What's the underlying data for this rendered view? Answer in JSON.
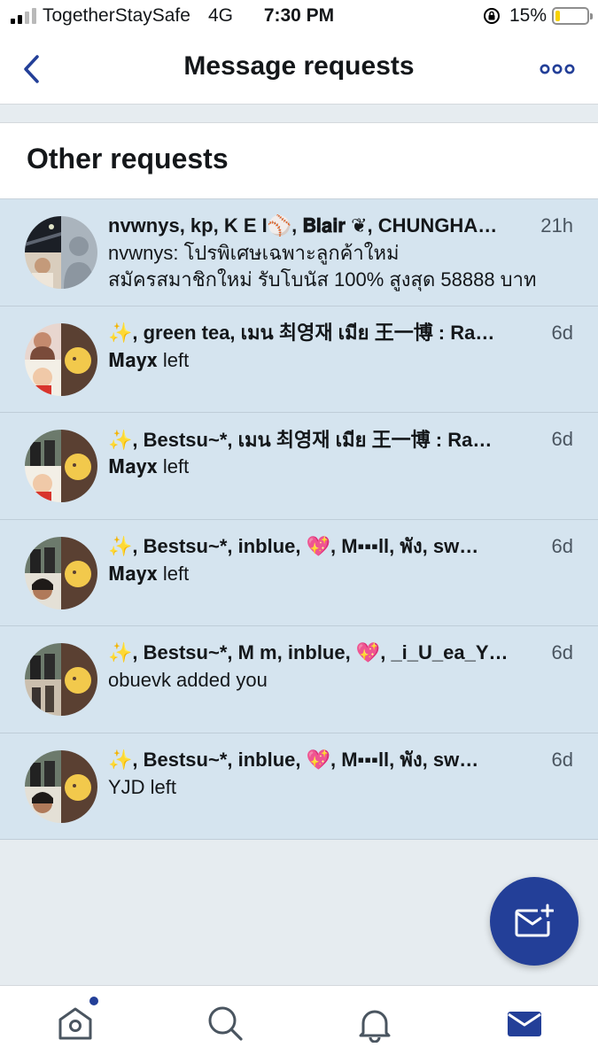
{
  "status_bar": {
    "carrier": "TogetherStaySafe",
    "network": "4G",
    "time": "7:30 PM",
    "battery": "15%",
    "battery_level": 0.15
  },
  "header": {
    "title": "Message requests",
    "back_icon": "chevron-left-icon",
    "more_icon": "more-horizontal-icon"
  },
  "section": {
    "title": "Other requests"
  },
  "requests": [
    {
      "names": "nvwnys, kp, K E I⚾️, 𝐁𝐥𝐚𝐢𝐫 ❦, CHUNGHA…",
      "time": "21h",
      "preview": "nvwnys: โปรพิเศษเฉพาะลูกค้าใหม่",
      "preview2": "สมัครสมาชิกใหม่ รับโบนัส 100% สูงสุด 58888 บาท"
    },
    {
      "names": "✨, green tea, เมน 최영재 เมีย 王一博 : Ra…",
      "time": "6d",
      "preview": "𝐌𝐚𝐲𝐱 left"
    },
    {
      "names": "✨, Bestsu~*, เมน 최영재 เมีย 王一博 : Ra…",
      "time": "6d",
      "preview": "𝐌𝐚𝐲𝐱 left"
    },
    {
      "names": "✨, Bestsu~*, inblue, 💖, M▪▪▪ll, พัง, sw…",
      "time": "6d",
      "preview": "𝐌𝐚𝐲𝐱 left"
    },
    {
      "names": "✨, Bestsu~*, M m, inblue, 💖, _i_U_ea_Y…",
      "time": "6d",
      "preview": "obuevk added you"
    },
    {
      "names": "✨, Bestsu~*, inblue, 💖, M▪▪▪ll, พัง, sw…",
      "time": "6d",
      "preview": "YJD left"
    }
  ],
  "fab": {
    "icon": "new-message-icon"
  },
  "tabs": [
    {
      "icon": "home-icon",
      "active": false,
      "badge": true
    },
    {
      "icon": "search-icon",
      "active": false
    },
    {
      "icon": "bell-icon",
      "active": false
    },
    {
      "icon": "mail-icon",
      "active": true
    }
  ],
  "colors": {
    "accent": "#233f98",
    "row_bg": "#d5e4ef",
    "page_bg": "#e6ecf0"
  }
}
